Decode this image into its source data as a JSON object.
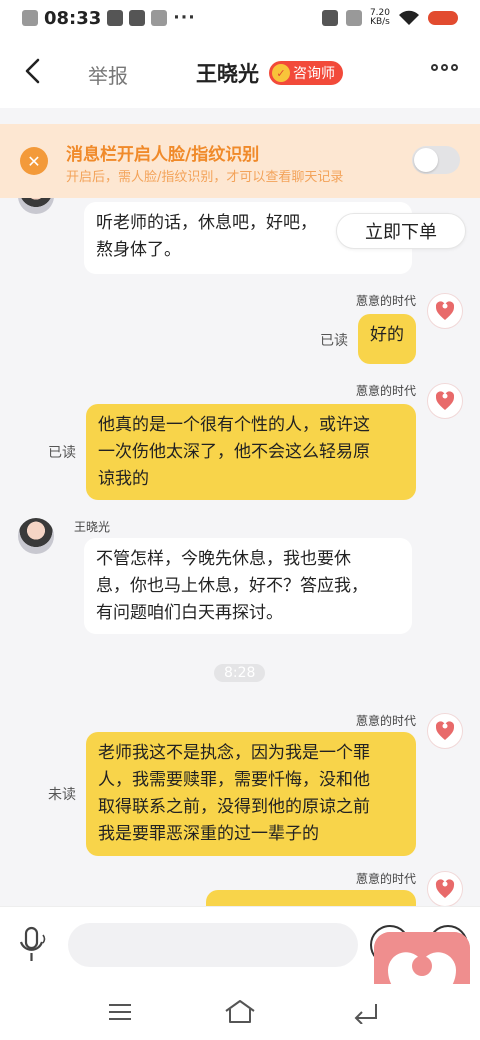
{
  "status_bar": {
    "time": "08:33",
    "dots": "···",
    "speed_value": "7.20",
    "speed_unit": "KB/s"
  },
  "header": {
    "report_label": "举报",
    "title": "王晓光",
    "badge_label": "咨询师"
  },
  "notice": {
    "title": "消息栏开启人脸/指纹识别",
    "subtitle": "开启后，需人脸/指纹识别，才可以查看聊天记录",
    "toggle_on": false
  },
  "actions": {
    "order_label": "立即下单"
  },
  "messages": [
    {
      "side": "left",
      "sender": "",
      "text_lines": [
        "听老师的话，休息吧，好吧，",
        "熬身体了。"
      ],
      "status": ""
    },
    {
      "side": "right",
      "sender": "蒽意的时代",
      "text_lines": [
        "好的"
      ],
      "status": "已读"
    },
    {
      "side": "right",
      "sender": "蒽意的时代",
      "text_lines": [
        "他真的是一个很有个性的人，或许这",
        "一次伤他太深了，他不会这么轻易原",
        "谅我的"
      ],
      "status": "已读"
    },
    {
      "side": "left",
      "sender": "王晓光",
      "text_lines": [
        "不管怎样，今晚先休息，我也要休",
        "息，你也马上休息，好不？答应我，",
        "有问题咱们白天再探讨。"
      ],
      "status": ""
    },
    {
      "side": "center",
      "time": "8:28"
    },
    {
      "side": "right",
      "sender": "蒽意的时代",
      "text_lines": [
        "老师我这不是执念，因为我是一个罪",
        "人，我需要赎罪，需要忏悔，没和他",
        "取得联系之前，没得到他的原谅之前",
        "我是要罪恶深重的过一辈子的"
      ],
      "status": "未读"
    },
    {
      "side": "right",
      "sender": "蒽意的时代",
      "text_lines": [],
      "status": ""
    }
  ],
  "input": {
    "placeholder": "",
    "value": ""
  },
  "colors": {
    "accent_yellow": "#f8d44a",
    "notice_bg": "#fde7d2",
    "notice_text": "#f08a2a",
    "badge_red": "#f24a3a",
    "heart_pink": "#ef8e8e"
  }
}
